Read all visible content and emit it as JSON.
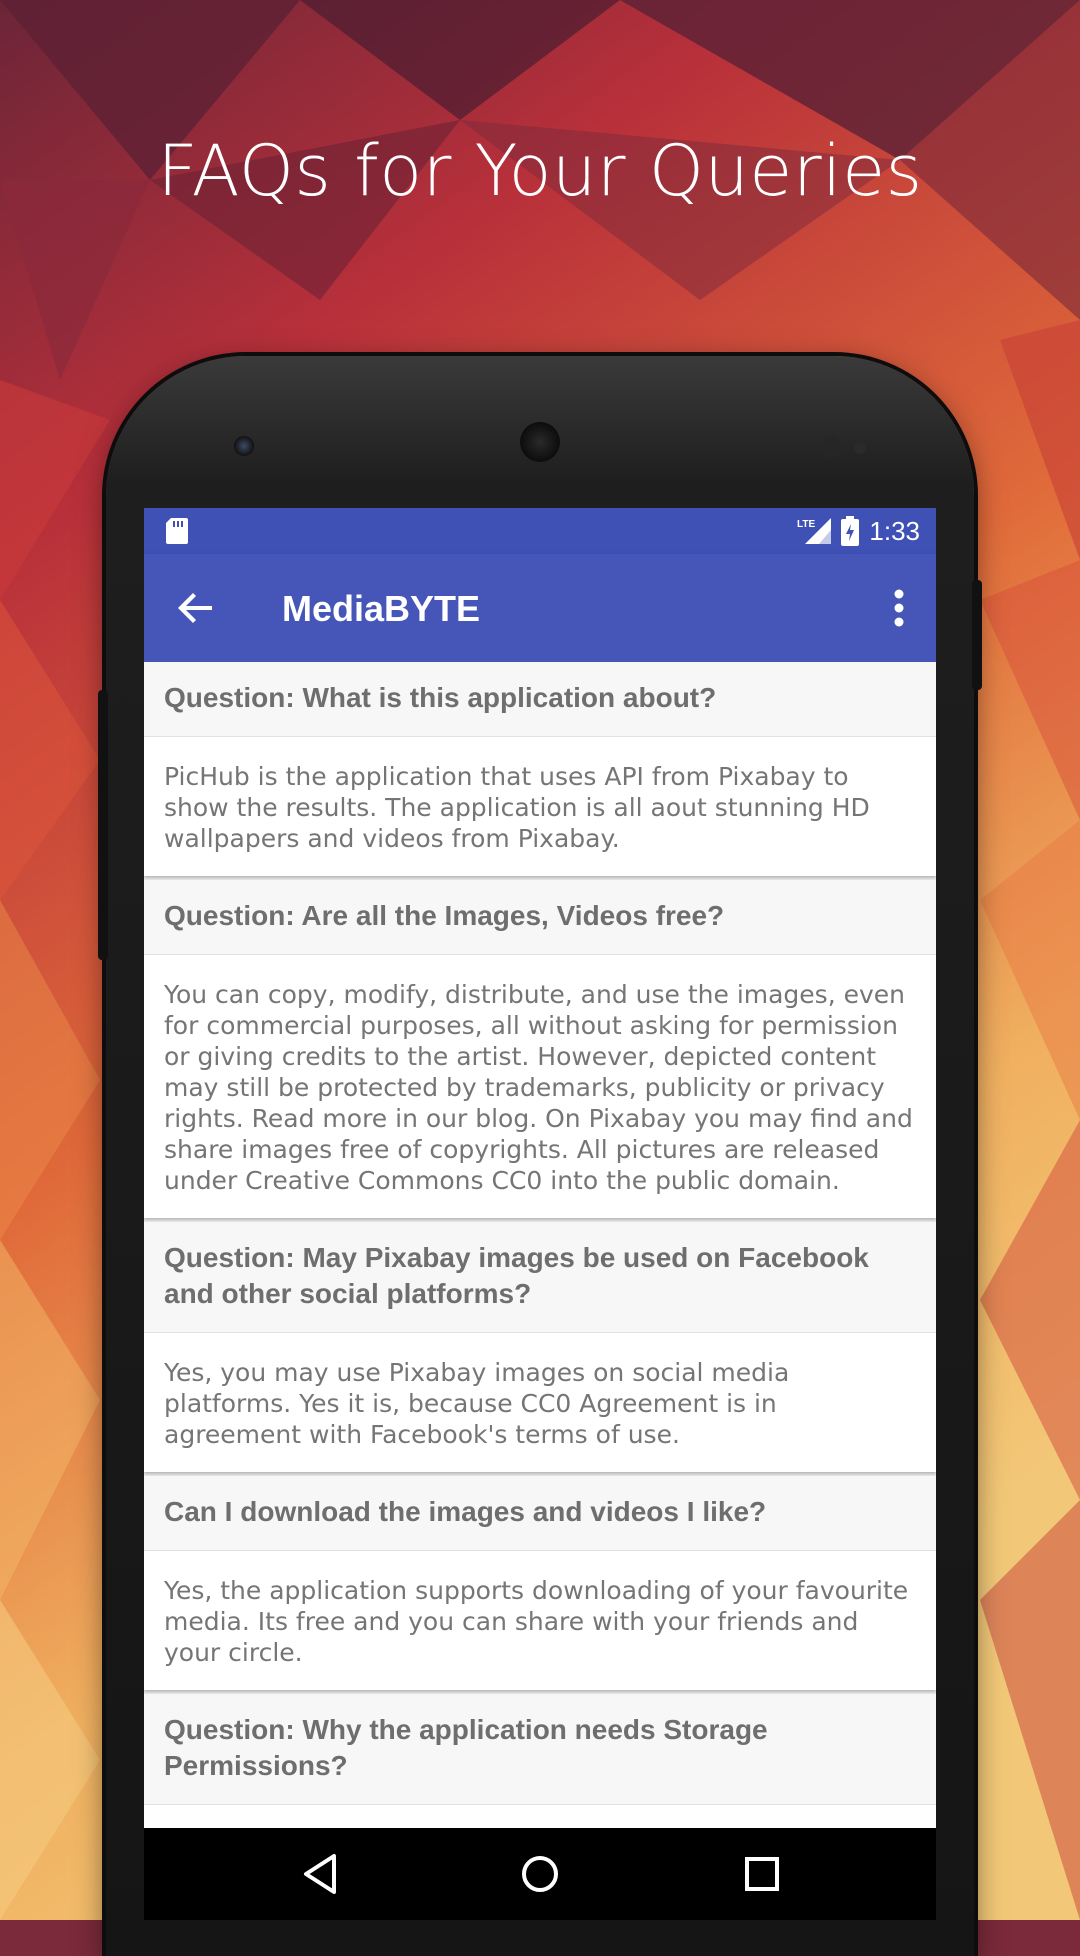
{
  "headline": "FAQs for Your Queries",
  "status_bar": {
    "time": "1:33",
    "network": "LTE"
  },
  "app_bar": {
    "title": "MediaBYTE"
  },
  "faqs": [
    {
      "question": "Question: What is this application about?",
      "answer": "PicHub is the application that uses API from Pixabay to show the results. The application is all aout stunning HD wallpapers and videos from Pixabay."
    },
    {
      "question": "Question: Are all the Images, Videos free?",
      "answer": "You can copy, modify, distribute, and use the images, even for commercial purposes, all without asking for permission or giving credits to the artist. However, depicted content may still be protected by trademarks, publicity or privacy rights. Read more in our blog. On Pixabay you may find and share images free of copyrights. All pictures are released under Creative Commons CC0 into the public domain."
    },
    {
      "question": "Question: May Pixabay images be used on Facebook and other social platforms?",
      "answer": "Yes, you may use Pixabay images on social media platforms. Yes it is, because CC0 Agreement is in agreement with Facebook's terms of use."
    },
    {
      "question": "Can I download the images and videos I like?",
      "answer": "Yes, the application supports downloading of your favourite media. Its free and you can share with your friends and your circle."
    },
    {
      "question": "Question: Why the application needs Storage Permissions?",
      "answer": ""
    }
  ],
  "colors": {
    "primary": "#3f51b5",
    "appbar": "#4556b8"
  },
  "icons": [
    "sd-card-icon",
    "lte-signal-icon",
    "battery-icon",
    "back-arrow-icon",
    "more-vert-icon",
    "nav-back-icon",
    "nav-home-icon",
    "nav-recents-icon"
  ]
}
